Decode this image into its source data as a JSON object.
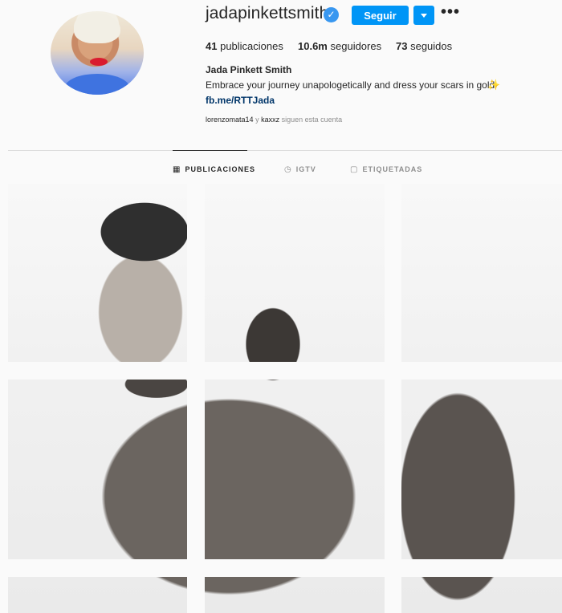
{
  "profile": {
    "username": "jadapinkettsmith",
    "verified_icon": "check-icon",
    "follow_label": "Seguir",
    "more_label": "•••",
    "stats": {
      "posts_count": "41",
      "posts_label": "publicaciones",
      "followers_count": "10.6m",
      "followers_label": "seguidores",
      "following_count": "73",
      "following_label": "seguidos"
    },
    "full_name": "Jada Pinkett Smith",
    "bio": "Embrace your journey unapologetically and dress your scars in gold",
    "bio_emoji": "✨",
    "link": "fb.me/RTTJada",
    "followed_by": {
      "user1": "lorenzomata14",
      "connector": "y",
      "user2": "kaxxz",
      "suffix": "siguen esta cuenta"
    }
  },
  "tabs": [
    {
      "label": "PUBLICACIONES",
      "icon": "grid-icon",
      "active": true
    },
    {
      "label": "IGTV",
      "icon": "igtv-icon",
      "active": false
    },
    {
      "label": "ETIQUETADAS",
      "icon": "tagged-icon",
      "active": false
    }
  ],
  "colors": {
    "accent": "#0095f6",
    "verified": "#3897f0",
    "link": "#003569"
  }
}
